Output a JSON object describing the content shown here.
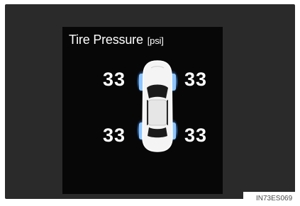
{
  "display": {
    "title": "Tire Pressure",
    "unit": "[psi]"
  },
  "tires": {
    "front_left": "33",
    "front_right": "33",
    "rear_left": "33",
    "rear_right": "33"
  },
  "colors": {
    "background": "#2a2a2a",
    "panel": "#070707",
    "text": "#ffffff",
    "tire_highlight": "#6fb4ff",
    "car_body": "#ffffff"
  },
  "icons": {
    "vehicle": "car-top-view-icon"
  },
  "image_ref": "IN73ES069"
}
